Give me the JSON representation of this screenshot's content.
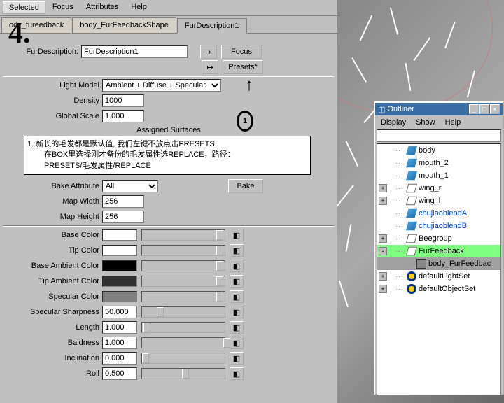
{
  "menu": {
    "selected": "Selected",
    "focus": "Focus",
    "attributes": "Attributes",
    "help": "Help"
  },
  "tabs": {
    "t1": "ody_fureedback",
    "t2": "body_FurFeedbackShape",
    "t3": "FurDescription1"
  },
  "fd": {
    "label": "FurDescription:",
    "value": "FurDescription1"
  },
  "btns": {
    "focus": "Focus",
    "presets": "Presets*"
  },
  "lightmodel": {
    "label": "Light Model",
    "value": "Ambient + Diffuse + Specular"
  },
  "density": {
    "label": "Density",
    "value": "1000"
  },
  "gscale": {
    "label": "Global Scale",
    "value": "1.000"
  },
  "assigned": "Assigned Surfaces",
  "note": {
    "l1": "1.  新长的毛发都是默认值, 我们左键不放点击PRESETS,",
    "l2": "在BOX里选择刚才备份的毛发属性选REPLACE，路径：",
    "l3": "PRESETS/毛发属性/REPLACE"
  },
  "bake": {
    "label": "Bake Attribute",
    "value": "All",
    "btn": "Bake"
  },
  "mapw": {
    "label": "Map Width",
    "value": "256"
  },
  "maph": {
    "label": "Map Height",
    "value": "256"
  },
  "clr": {
    "base": {
      "label": "Base Color",
      "hex": "#ffffff"
    },
    "tip": {
      "label": "Tip Color",
      "hex": "#ffffff"
    },
    "bamb": {
      "label": "Base Ambient Color",
      "hex": "#000000"
    },
    "tamb": {
      "label": "Tip Ambient Color",
      "hex": "#323232"
    },
    "spec": {
      "label": "Specular Color",
      "hex": "#808080"
    }
  },
  "num": {
    "sharp": {
      "label": "Specular Sharpness",
      "value": "50.000",
      "pos": 18
    },
    "len": {
      "label": "Length",
      "value": "1.000",
      "pos": 2
    },
    "bald": {
      "label": "Baldness",
      "value": "1.000",
      "pos": 98
    },
    "inc": {
      "label": "Inclination",
      "value": "0.000",
      "pos": 0
    },
    "roll": {
      "label": "Roll",
      "value": "0.500",
      "pos": 48
    }
  },
  "ann": {
    "big": "4.",
    "circ": "1"
  },
  "outliner": {
    "title": "Outliner",
    "menu": {
      "d": "Display",
      "s": "Show",
      "h": "Help"
    },
    "items": [
      {
        "name": "body",
        "ic": "mesh"
      },
      {
        "name": "mouth_2",
        "ic": "mesh"
      },
      {
        "name": "mouth_1",
        "ic": "mesh"
      },
      {
        "name": "wing_r",
        "ic": "empty",
        "tg": "+"
      },
      {
        "name": "wing_l",
        "ic": "empty",
        "tg": "+"
      },
      {
        "name": "chujiaoblendA",
        "ic": "mesh",
        "blue": true
      },
      {
        "name": "chujiaoblendB",
        "ic": "mesh",
        "blue": true
      },
      {
        "name": "Beegroup",
        "ic": "empty",
        "tg": "+"
      },
      {
        "name": "FurFeedback",
        "ic": "empty",
        "tg": "-",
        "sel": true
      },
      {
        "name": "body_FurFeedbac",
        "ic": "grp",
        "sel2": true,
        "indent": true
      },
      {
        "name": "defaultLightSet",
        "ic": "light",
        "tg": "+"
      },
      {
        "name": "defaultObjectSet",
        "ic": "light",
        "tg": "+"
      }
    ]
  }
}
